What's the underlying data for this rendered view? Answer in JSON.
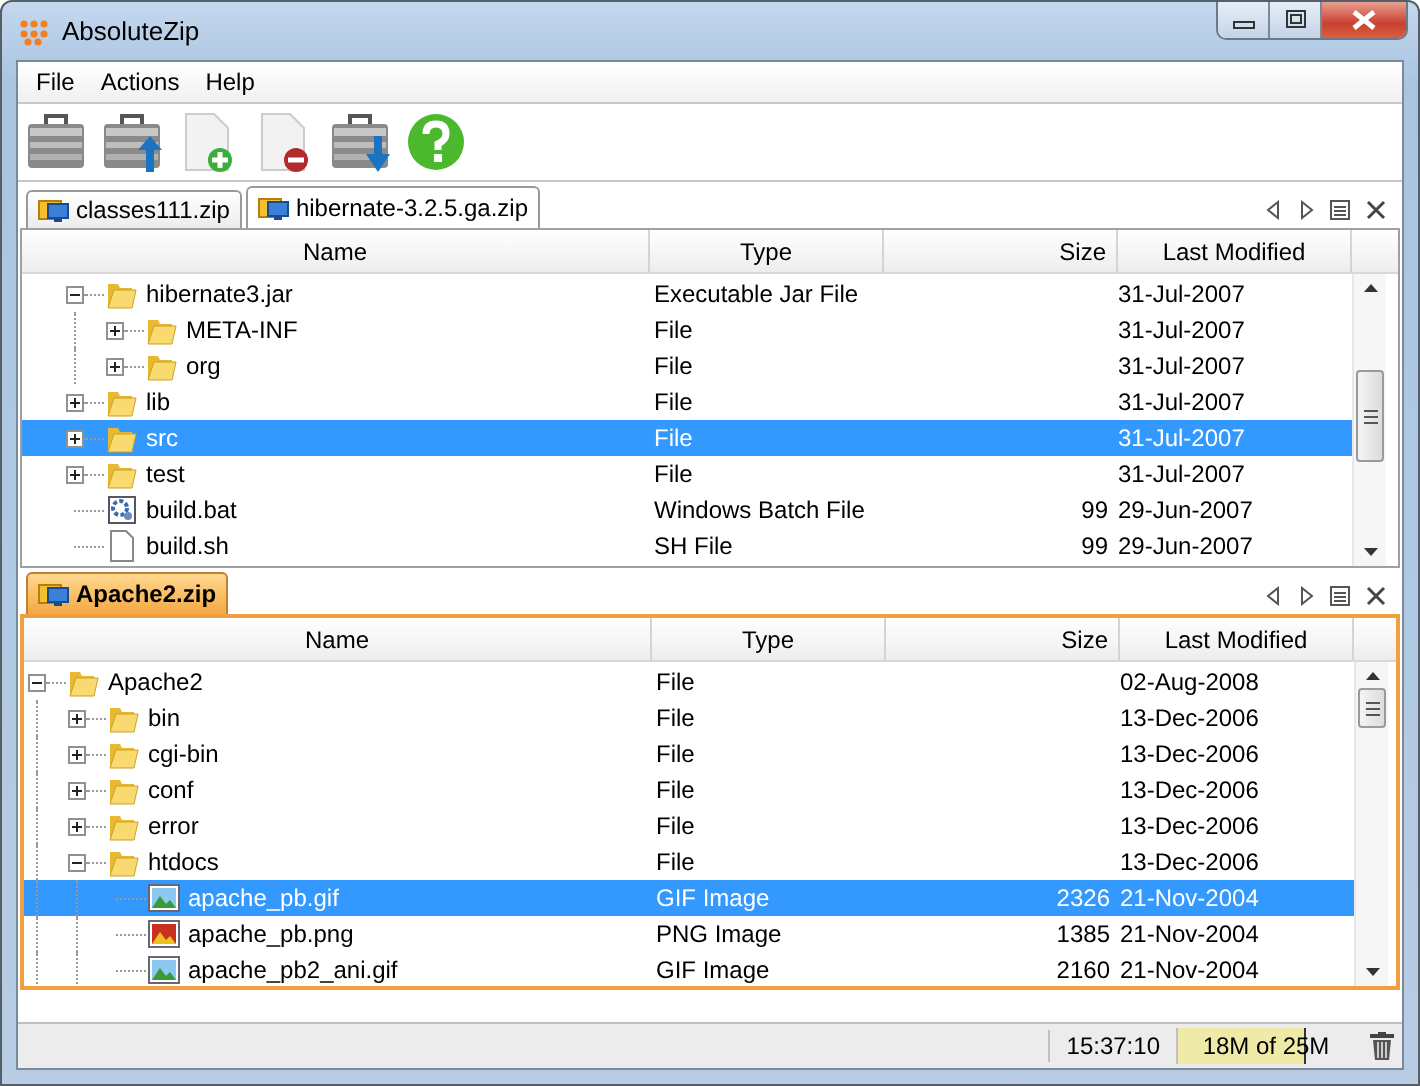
{
  "window": {
    "title": "AbsoluteZip"
  },
  "menu": [
    "File",
    "Actions",
    "Help"
  ],
  "toolbar": [
    {
      "kind": "case"
    },
    {
      "kind": "case-up"
    },
    {
      "kind": "doc-add"
    },
    {
      "kind": "doc-remove"
    },
    {
      "kind": "case-down"
    },
    {
      "kind": "help"
    }
  ],
  "panels": [
    {
      "active": false,
      "tabs": [
        {
          "label": "classes111.zip",
          "selected": false
        },
        {
          "label": "hibernate-3.2.5.ga.zip",
          "selected": true
        }
      ],
      "columns": [
        "Name",
        "Type",
        "Size",
        "Last Modified"
      ],
      "rows": [
        {
          "kind": "folder",
          "name": "hibernate3.jar",
          "type": "Executable Jar File",
          "modified": "31-Jul-2007",
          "expanded": true,
          "selected": false,
          "children": [
            {
              "kind": "folder",
              "name": "META-INF",
              "type": "File",
              "modified": "31-Jul-2007",
              "expanded": false,
              "selected": false
            },
            {
              "kind": "folder",
              "name": "org",
              "type": "File",
              "modified": "31-Jul-2007",
              "expanded": false,
              "selected": false
            }
          ]
        },
        {
          "kind": "folder",
          "name": "lib",
          "type": "File",
          "modified": "31-Jul-2007",
          "expanded": false,
          "selected": false
        },
        {
          "kind": "folder",
          "name": "src",
          "type": "File",
          "modified": "31-Jul-2007",
          "expanded": false,
          "selected": true
        },
        {
          "kind": "folder",
          "name": "test",
          "type": "File",
          "modified": "31-Jul-2007",
          "expanded": false,
          "selected": false
        },
        {
          "kind": "batch",
          "name": "build.bat",
          "type": "Windows Batch File",
          "size": "99",
          "modified": "29-Jun-2007",
          "selected": false
        },
        {
          "kind": "file",
          "name": "build.sh",
          "type": "SH File",
          "size": "99",
          "modified": "29-Jun-2007",
          "selected": false
        }
      ]
    },
    {
      "active": true,
      "tabs": [
        {
          "label": "Apache2.zip",
          "selected": true
        }
      ],
      "columns": [
        "Name",
        "Type",
        "Size",
        "Last Modified"
      ],
      "rows": [
        {
          "kind": "folder",
          "name": "Apache2",
          "type": "File",
          "modified": "02-Aug-2008",
          "expanded": true,
          "selected": false,
          "children": [
            {
              "kind": "folder",
              "name": "bin",
              "type": "File",
              "modified": "13-Dec-2006",
              "expanded": false,
              "selected": false
            },
            {
              "kind": "folder",
              "name": "cgi-bin",
              "type": "File",
              "modified": "13-Dec-2006",
              "expanded": false,
              "selected": false
            },
            {
              "kind": "folder",
              "name": "conf",
              "type": "File",
              "modified": "13-Dec-2006",
              "expanded": false,
              "selected": false
            },
            {
              "kind": "folder",
              "name": "error",
              "type": "File",
              "modified": "13-Dec-2006",
              "expanded": false,
              "selected": false
            },
            {
              "kind": "folder",
              "name": "htdocs",
              "type": "File",
              "modified": "13-Dec-2006",
              "expanded": true,
              "selected": false,
              "children": [
                {
                  "kind": "image",
                  "name": "apache_pb.gif",
                  "type": "GIF Image",
                  "size": "2326",
                  "modified": "21-Nov-2004",
                  "selected": true
                },
                {
                  "kind": "image-red",
                  "name": "apache_pb.png",
                  "type": "PNG Image",
                  "size": "1385",
                  "modified": "21-Nov-2004",
                  "selected": false
                },
                {
                  "kind": "image",
                  "name": "apache_pb2_ani.gif",
                  "type": "GIF Image",
                  "size": "2160",
                  "modified": "21-Nov-2004",
                  "selected": false
                }
              ]
            }
          ]
        }
      ]
    }
  ],
  "status_bar": {
    "time": "15:37:10",
    "memory": {
      "text": "18M of 25M",
      "level": 0.72
    }
  }
}
